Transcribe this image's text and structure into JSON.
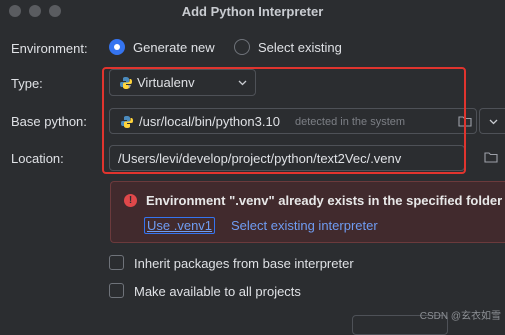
{
  "window": {
    "title": "Add Python Interpreter"
  },
  "environment": {
    "label": "Environment:",
    "options": [
      "Generate new",
      "Select existing"
    ],
    "selected": "Generate new"
  },
  "type": {
    "label": "Type:",
    "value": "Virtualenv"
  },
  "base_python": {
    "label": "Base python:",
    "value": "/usr/local/bin/python3.10",
    "hint": "detected in the system"
  },
  "location": {
    "label": "Location:",
    "value": "/Users/levi/develop/project/python/text2Vec/.venv"
  },
  "warning": {
    "message": "Environment \".venv\" already exists in the specified folder",
    "link_use": "Use .venv1",
    "link_select": "Select existing interpreter"
  },
  "checkboxes": {
    "inherit": "Inherit packages from base interpreter",
    "available": "Make available to all projects"
  },
  "watermark": "CSDN @玄衣如雪",
  "colors": {
    "accent": "#3574f0",
    "annotation_box": "#e0342e",
    "warning_bg": "#412a2d"
  }
}
